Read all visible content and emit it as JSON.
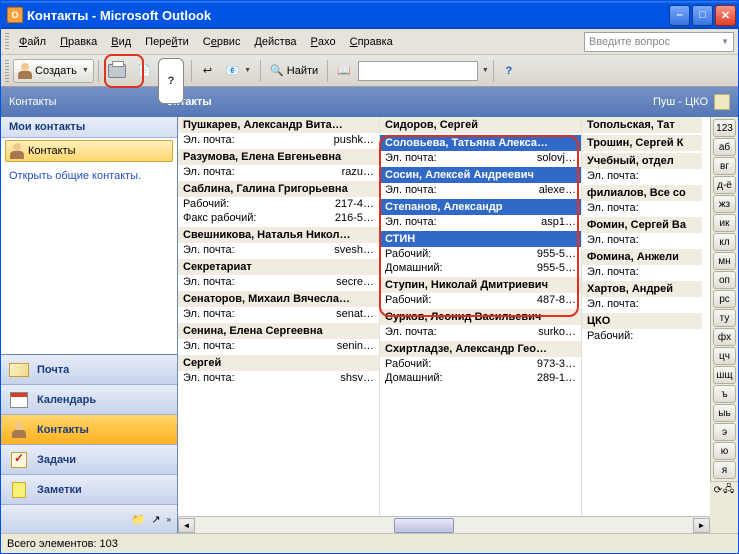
{
  "title": "Контакты - Microsoft Outlook",
  "menu": {
    "file": "Файл",
    "edit": "Правка",
    "view": "Вид",
    "go": "Перейти",
    "service": "Сервис",
    "actions": "Действия",
    "raxo": "Paxo",
    "help": "Справка"
  },
  "search_placeholder": "Введите вопрос",
  "toolbar": {
    "create": "Создать",
    "find": "Найти"
  },
  "tooltip": "?",
  "header": {
    "left": "Контакты",
    "mid": "онтакты",
    "right": "Пуш - ЦКО"
  },
  "nav": {
    "header": "Мои контакты",
    "sel": "Контакты",
    "link": "Открыть общие контакты.",
    "mail": "Почта",
    "cal": "Календарь",
    "contacts": "Контакты",
    "tasks": "Задачи",
    "notes": "Заметки"
  },
  "labels": {
    "email": "Эл. почта:",
    "work": "Рабочий:",
    "home": "Домашний:",
    "fax": "Факс рабочий:"
  },
  "cols": [
    [
      {
        "name": "Пушкарев, Александр Вита…",
        "rows": [
          [
            "email",
            "pushk…"
          ]
        ]
      },
      {
        "name": "Разумова, Елена Евгеньевна",
        "rows": [
          [
            "email",
            "razu…"
          ]
        ]
      },
      {
        "name": "Саблина, Галина Григорьевна",
        "rows": [
          [
            "work",
            "217-4…"
          ],
          [
            "fax",
            "216-5…"
          ]
        ]
      },
      {
        "name": "Свешникова, Наталья Никол…",
        "rows": [
          [
            "email",
            "svesh…"
          ]
        ]
      },
      {
        "name": "Секретариат",
        "rows": [
          [
            "email",
            "secre…"
          ]
        ]
      },
      {
        "name": "Сенаторов, Михаил Вячесла…",
        "rows": [
          [
            "email",
            "senat…"
          ]
        ]
      },
      {
        "name": "Сенина, Елена Сергеевна",
        "rows": [
          [
            "email",
            "senin…"
          ]
        ]
      },
      {
        "name": "Сергей",
        "rows": [
          [
            "email",
            "shsv…"
          ]
        ]
      }
    ],
    [
      {
        "name": "Сидоров, Сергей",
        "rows": []
      },
      {
        "name": "Соловьева, Татьяна Алекса…",
        "sel": true,
        "rows": [
          [
            "email",
            "solovj…"
          ]
        ]
      },
      {
        "name": "Сосин, Алексей Андреевич",
        "sel": true,
        "rows": [
          [
            "email",
            "alexe…"
          ]
        ]
      },
      {
        "name": "Степанов, Александр",
        "sel": true,
        "rows": [
          [
            "email",
            "asp1…"
          ]
        ]
      },
      {
        "name": "СТИН",
        "sel": true,
        "rows": [
          [
            "work",
            "955-5…"
          ],
          [
            "home",
            "955-5…"
          ]
        ]
      },
      {
        "name": "Ступин, Николай Дмитриевич",
        "rows": [
          [
            "work",
            "487-8…"
          ]
        ]
      },
      {
        "name": "Сурков, Леонид Васильевич",
        "rows": [
          [
            "email",
            "surko…"
          ]
        ]
      },
      {
        "name": "Схиртладзе, Александр Гео…",
        "rows": [
          [
            "work",
            "973-3…"
          ],
          [
            "home",
            "289-1…"
          ]
        ]
      }
    ],
    [
      {
        "name": "Топольская, Тат",
        "rows": []
      },
      {
        "name": "Трошин, Сергей К",
        "rows": []
      },
      {
        "name": "Учебный, отдел",
        "rows": [
          [
            "email",
            ""
          ]
        ]
      },
      {
        "name": "филиалов, Все со",
        "rows": [
          [
            "email",
            ""
          ]
        ]
      },
      {
        "name": "Фомин, Сергей Ва",
        "rows": [
          [
            "email",
            ""
          ]
        ]
      },
      {
        "name": "Фомина, Анжели",
        "rows": [
          [
            "email",
            ""
          ]
        ]
      },
      {
        "name": "Хартов, Андрей",
        "rows": [
          [
            "email",
            ""
          ]
        ]
      },
      {
        "name": "ЦКО",
        "rows": [
          [
            "work",
            ""
          ]
        ]
      }
    ]
  ],
  "index": [
    "123",
    "аб",
    "вг",
    "д-ё",
    "жз",
    "ик",
    "кл",
    "мн",
    "оп",
    "рс",
    "ту",
    "фх",
    "цч",
    "шщ",
    "ъ",
    "ыь",
    "э",
    "ю",
    "я"
  ],
  "status": "Всего элементов: 103"
}
